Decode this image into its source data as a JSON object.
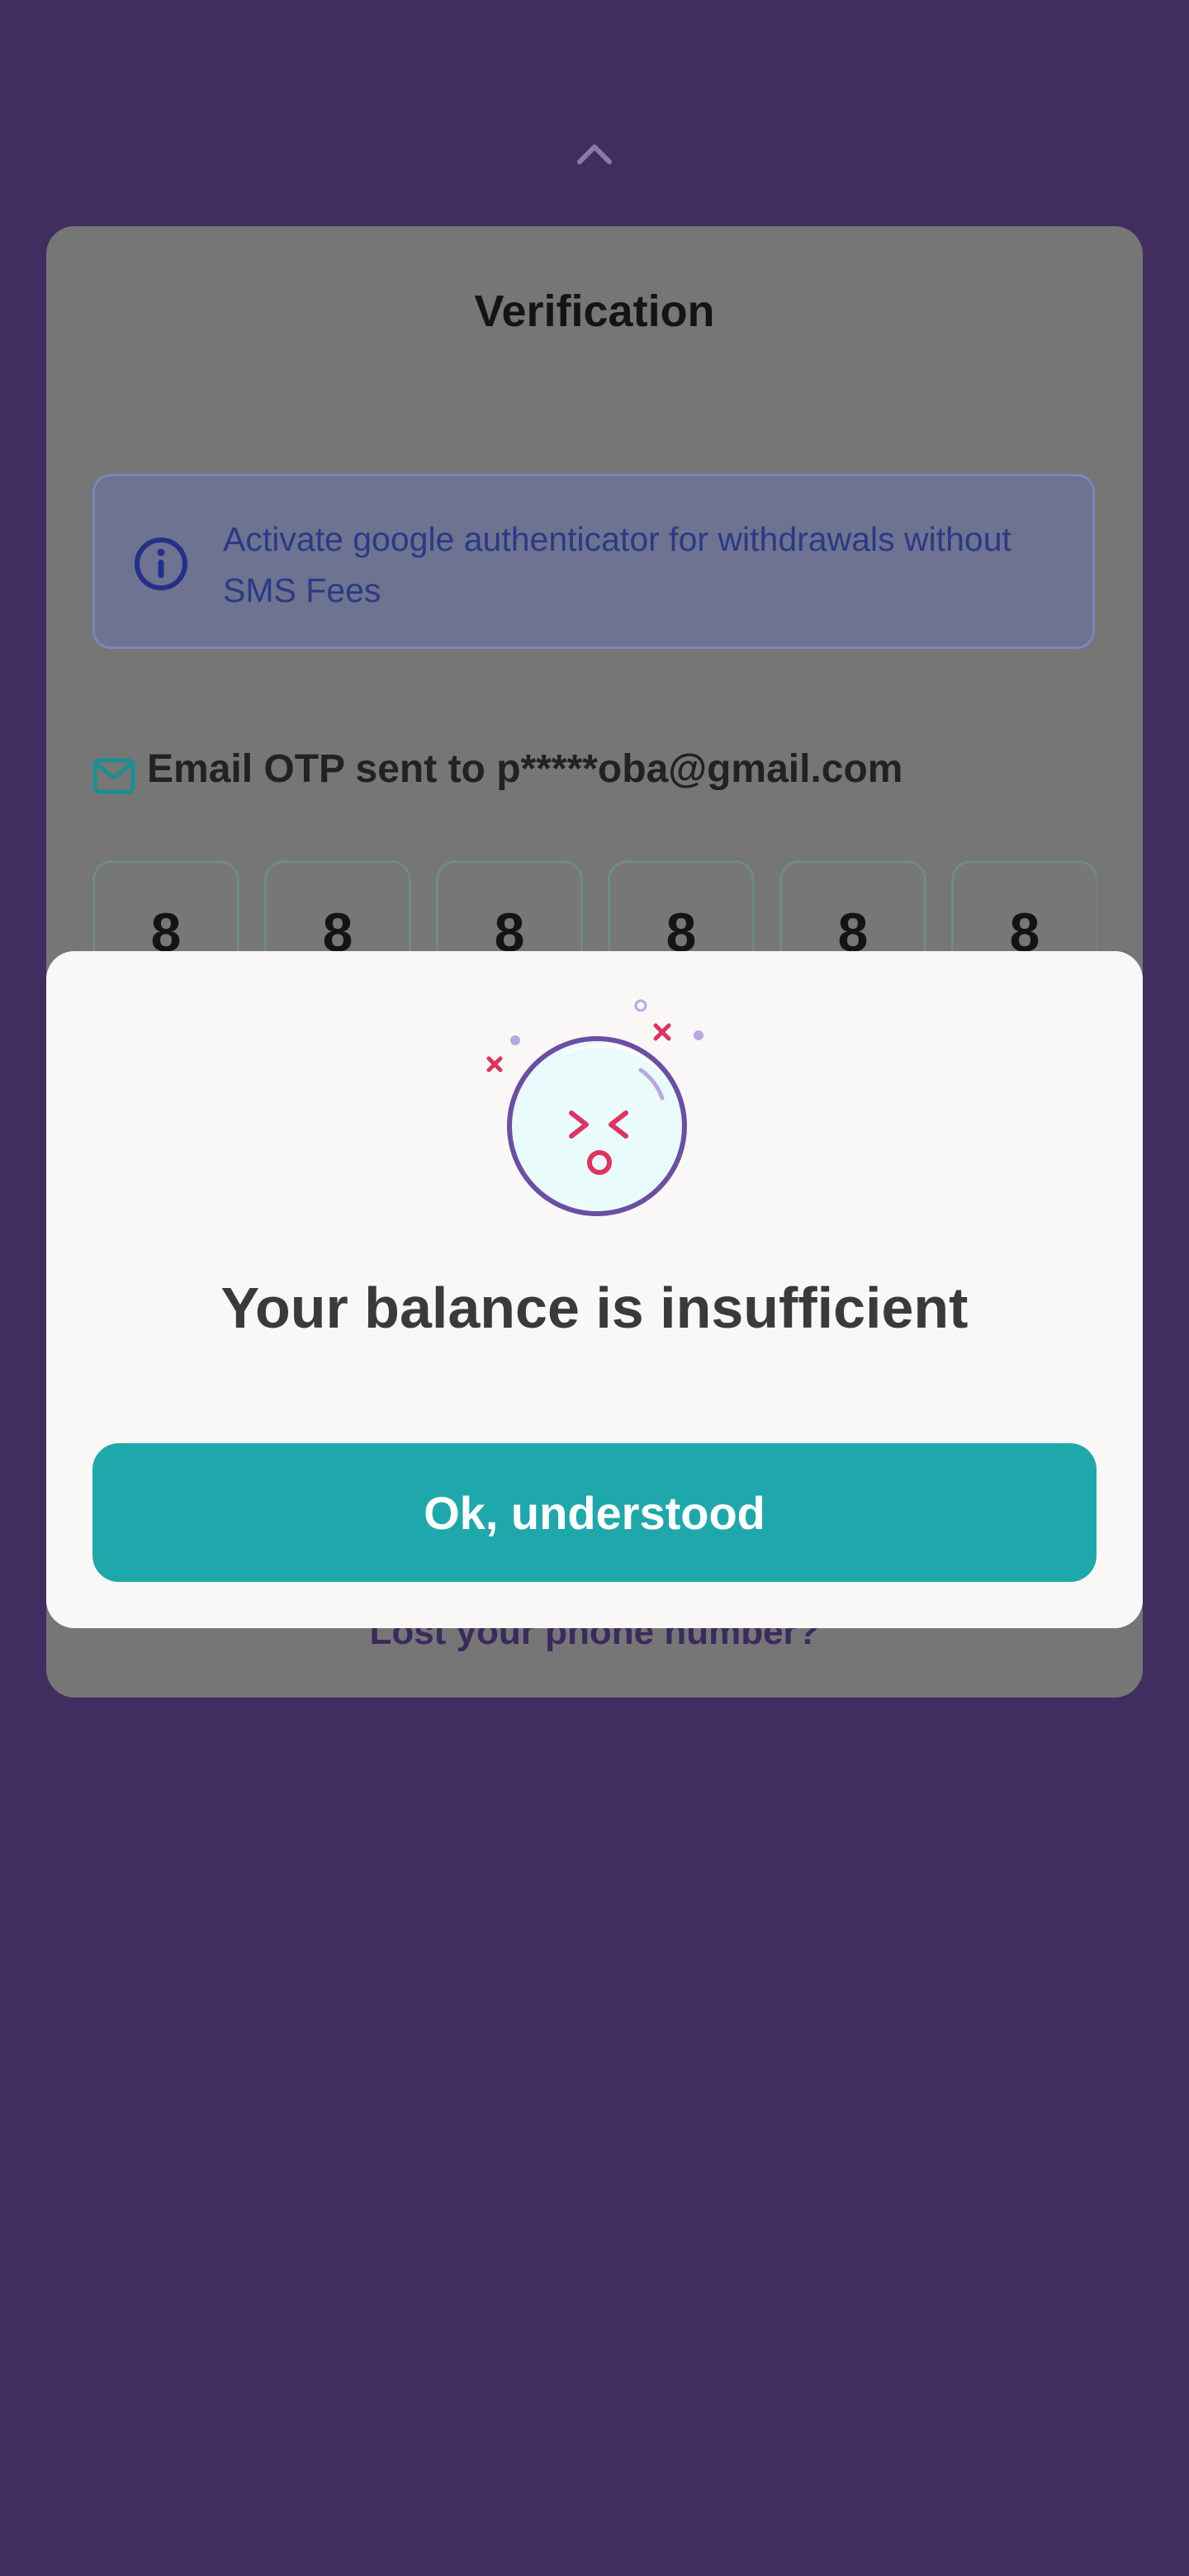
{
  "colors": {
    "backdrop": "#412d5f",
    "card": "#767676",
    "dialog": "#f9f8f7",
    "accent_teal": "#1fa8ab",
    "face_outline": "#6a4fa3",
    "face_features": "#e0335f"
  },
  "header": {
    "collapse_icon": "chevron-up-icon"
  },
  "verification": {
    "title": "Verification",
    "info_icon": "info-icon",
    "info_text": "Activate google authenticator for withdrawals without SMS Fees",
    "mail_icon": "mail-icon",
    "email_label": "Email OTP sent to p*****oba@gmail.com",
    "otp_digits": [
      "8",
      "8",
      "8",
      "8",
      "8",
      "8"
    ],
    "lost_phone_link": "Lost your phone number?"
  },
  "dialog": {
    "illustration": "sad-face-icon",
    "title": "Your balance is insufficient",
    "button_label": "Ok, understood"
  }
}
